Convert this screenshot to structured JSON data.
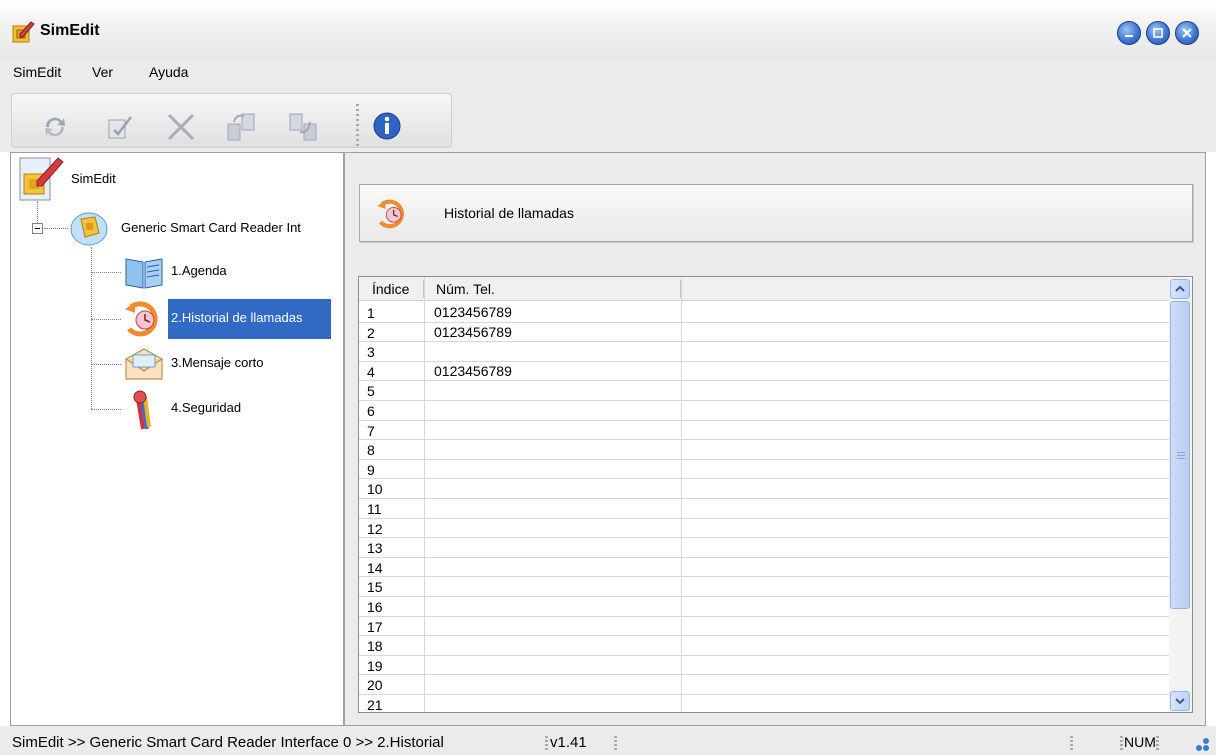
{
  "window": {
    "title": "SimEdit"
  },
  "menu": [
    "SimEdit",
    "Ver",
    "Ayuda"
  ],
  "toolbar": {
    "icons": [
      "refresh-icon",
      "edit-icon",
      "delete-icon",
      "copy-to-sim-icon",
      "copy-from-sim-icon",
      "info-icon"
    ]
  },
  "tree": {
    "root": "SimEdit",
    "reader": "Generic Smart Card Reader Int",
    "items": [
      "1.Agenda",
      "2.Historial de llamadas",
      "3.Mensaje corto",
      "4.Seguridad"
    ],
    "selected_index": 1
  },
  "header": {
    "title": "Historial de llamadas"
  },
  "grid": {
    "columns": [
      "Índice",
      "Núm. Tel."
    ],
    "rows": [
      [
        "1",
        "0123456789"
      ],
      [
        "2",
        "0123456789"
      ],
      [
        "3",
        ""
      ],
      [
        "4",
        "0123456789"
      ],
      [
        "5",
        ""
      ],
      [
        "6",
        ""
      ],
      [
        "7",
        ""
      ],
      [
        "8",
        ""
      ],
      [
        "9",
        ""
      ],
      [
        "10",
        ""
      ],
      [
        "11",
        ""
      ],
      [
        "12",
        ""
      ],
      [
        "13",
        ""
      ],
      [
        "14",
        ""
      ],
      [
        "15",
        ""
      ],
      [
        "16",
        ""
      ],
      [
        "17",
        ""
      ],
      [
        "18",
        ""
      ],
      [
        "19",
        ""
      ],
      [
        "20",
        ""
      ],
      [
        "21",
        ""
      ]
    ]
  },
  "status": {
    "path": "SimEdit  >>  Generic Smart Card Reader Interface 0  >>  2.Historial",
    "version": "v1.41",
    "num": "NUM"
  },
  "colors": {
    "selection": "#316ac5",
    "window_bg": "#ebebeb"
  }
}
